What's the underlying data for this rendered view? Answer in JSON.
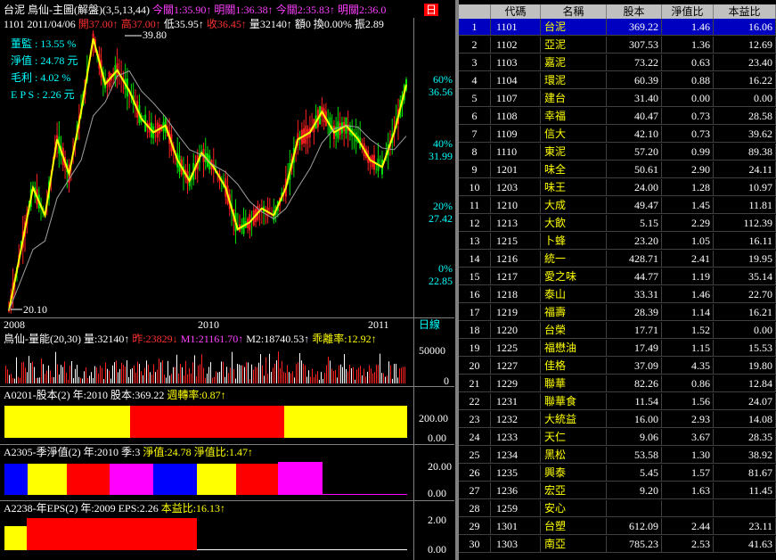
{
  "header": {
    "stock_name": "台泥",
    "title": "鳥仙-主圖(解盤)(3,5,13,44)",
    "today_close": "今關1:35.90↑",
    "tomorrow_close": "明關1:36.38↑",
    "today_close2": "今關2:35.83↑",
    "tomorrow_close2": "明關2:36.0",
    "flag": "日",
    "line2_code_date": "1101 2011/04/06",
    "open": "開37.00↑",
    "high": "高37.00↑",
    "low": "低35.95↑",
    "close": "收36.45↑",
    "volume": "量32140↑",
    "amount": "額0",
    "turnover": "換0.00%",
    "amplitude": "振2.89"
  },
  "overlay": {
    "supervisor": "董監 : 13.55 %",
    "net_value": "淨值 : 24.78 元",
    "gross_margin": "毛利 : 4.02 %",
    "eps": "E P S : 2.26 元"
  },
  "main_chart": {
    "price_high_label": "39.80",
    "price_low_label": "20.10",
    "right_axis": [
      {
        "pct": "60%",
        "price": "36.56"
      },
      {
        "pct": "40%",
        "price": "31.99"
      },
      {
        "pct": "20%",
        "price": "27.42"
      },
      {
        "pct": "0%",
        "price": "22.85"
      }
    ],
    "year_labels": [
      "2008",
      "2010",
      "2011"
    ],
    "period": "日線"
  },
  "chart_data": [
    {
      "type": "line",
      "title": "鳥仙-主圖(解盤)(3,5,13,44)",
      "series": [
        {
          "name": "price",
          "values": [
            20.1,
            24.5,
            29.0,
            27.0,
            32.5,
            30.0,
            34.5,
            39.8,
            36.5,
            37.5,
            36.0,
            34.0,
            33.0,
            33.5,
            31.0,
            29.5,
            31.5,
            30.5,
            29.0,
            26.0,
            26.5,
            27.5,
            27.0,
            29.0,
            32.5,
            33.0,
            34.5,
            33.0,
            33.5,
            32.5,
            31.0,
            30.5,
            33.0,
            36.45
          ]
        }
      ],
      "ylim": [
        20,
        40
      ]
    },
    {
      "type": "bar",
      "title": "鳥仙-量能(20,30)",
      "series": [
        {
          "name": "量",
          "values": [
            32140
          ]
        }
      ],
      "yticks": [
        0,
        50000
      ]
    },
    {
      "type": "bar",
      "title": "A0201-股本(2)",
      "values": [
        369.22
      ],
      "yticks": [
        "0.00",
        "200.00"
      ]
    },
    {
      "type": "bar",
      "title": "A2305-季淨值(2)",
      "values": [
        24.78
      ],
      "yticks": [
        "0.00",
        "20.00"
      ]
    },
    {
      "type": "bar",
      "title": "A2238-年EPS(2)",
      "values": [
        2.26
      ],
      "yticks": [
        "0.00",
        "2.00"
      ]
    }
  ],
  "volume_panel": {
    "title": "鳥仙-量能(20,30)",
    "vol": "量:32140↑",
    "vol2": "昨:23829↓",
    "m1": "M1:21161.70↑",
    "m2": "M2:18740.53↑",
    "ratio": "乖離率:12.92↑",
    "tick_high": "50000",
    "tick_low": "0"
  },
  "capital_panel": {
    "code": "A0201-股本(2)",
    "year_label": "年:2010",
    "value": "股本:369.22",
    "extra": "週轉率:0.87↑",
    "tick_high": "200.00",
    "tick_low": "0.00"
  },
  "netvalue_panel": {
    "code": "A2305-季淨值(2)",
    "year_label": "年:2010",
    "quarter": "季:3",
    "value": "淨值:24.78",
    "ratio": "淨值比:1.47↑",
    "tick_high": "20.00",
    "tick_low": "0.00"
  },
  "eps_panel": {
    "code": "A2238-年EPS(2)",
    "year_label": "年:2009",
    "value": "EPS:2.26",
    "ratio": "本益比:16.13↑",
    "tick_high": "2.00",
    "tick_low": "0.00"
  },
  "table": {
    "headers": [
      "",
      "代碼",
      "名稱",
      "股本",
      "淨值比",
      "本益比"
    ],
    "rows": [
      {
        "n": "1",
        "code": "1101",
        "name": "台泥",
        "cap": "369.22",
        "pb": "1.46",
        "pe": "16.06"
      },
      {
        "n": "2",
        "code": "1102",
        "name": "亞泥",
        "cap": "307.53",
        "pb": "1.36",
        "pe": "12.69"
      },
      {
        "n": "3",
        "code": "1103",
        "name": "嘉泥",
        "cap": "73.22",
        "pb": "0.63",
        "pe": "23.40"
      },
      {
        "n": "4",
        "code": "1104",
        "name": "環泥",
        "cap": "60.39",
        "pb": "0.88",
        "pe": "16.22"
      },
      {
        "n": "5",
        "code": "1107",
        "name": "建台",
        "cap": "31.40",
        "pb": "0.00",
        "pe": "0.00"
      },
      {
        "n": "6",
        "code": "1108",
        "name": "幸福",
        "cap": "40.47",
        "pb": "0.73",
        "pe": "28.58"
      },
      {
        "n": "7",
        "code": "1109",
        "name": "信大",
        "cap": "42.10",
        "pb": "0.73",
        "pe": "39.62"
      },
      {
        "n": "8",
        "code": "1110",
        "name": "東泥",
        "cap": "57.20",
        "pb": "0.99",
        "pe": "89.38"
      },
      {
        "n": "9",
        "code": "1201",
        "name": "味全",
        "cap": "50.61",
        "pb": "2.90",
        "pe": "24.11"
      },
      {
        "n": "10",
        "code": "1203",
        "name": "味王",
        "cap": "24.00",
        "pb": "1.28",
        "pe": "10.97"
      },
      {
        "n": "11",
        "code": "1210",
        "name": "大成",
        "cap": "49.47",
        "pb": "1.45",
        "pe": "11.81"
      },
      {
        "n": "12",
        "code": "1213",
        "name": "大飲",
        "cap": "5.15",
        "pb": "2.29",
        "pe": "112.39"
      },
      {
        "n": "13",
        "code": "1215",
        "name": "卜蜂",
        "cap": "23.20",
        "pb": "1.05",
        "pe": "16.11"
      },
      {
        "n": "14",
        "code": "1216",
        "name": "統一",
        "cap": "428.71",
        "pb": "2.41",
        "pe": "19.95"
      },
      {
        "n": "15",
        "code": "1217",
        "name": "愛之味",
        "cap": "44.77",
        "pb": "1.19",
        "pe": "35.14"
      },
      {
        "n": "16",
        "code": "1218",
        "name": "泰山",
        "cap": "33.31",
        "pb": "1.46",
        "pe": "22.70"
      },
      {
        "n": "17",
        "code": "1219",
        "name": "福壽",
        "cap": "28.39",
        "pb": "1.14",
        "pe": "16.21"
      },
      {
        "n": "18",
        "code": "1220",
        "name": "台榮",
        "cap": "17.71",
        "pb": "1.52",
        "pe": "0.00"
      },
      {
        "n": "19",
        "code": "1225",
        "name": "福懋油",
        "cap": "17.49",
        "pb": "1.15",
        "pe": "15.53"
      },
      {
        "n": "20",
        "code": "1227",
        "name": "佳格",
        "cap": "37.09",
        "pb": "4.35",
        "pe": "19.80"
      },
      {
        "n": "21",
        "code": "1229",
        "name": "聯華",
        "cap": "82.26",
        "pb": "0.86",
        "pe": "12.84"
      },
      {
        "n": "22",
        "code": "1231",
        "name": "聯華食",
        "cap": "11.54",
        "pb": "1.56",
        "pe": "24.07"
      },
      {
        "n": "23",
        "code": "1232",
        "name": "大統益",
        "cap": "16.00",
        "pb": "2.93",
        "pe": "14.08"
      },
      {
        "n": "24",
        "code": "1233",
        "name": "天仁",
        "cap": "9.06",
        "pb": "3.67",
        "pe": "28.35"
      },
      {
        "n": "25",
        "code": "1234",
        "name": "黑松",
        "cap": "53.58",
        "pb": "1.30",
        "pe": "38.92"
      },
      {
        "n": "26",
        "code": "1235",
        "name": "興泰",
        "cap": "5.45",
        "pb": "1.57",
        "pe": "81.67"
      },
      {
        "n": "27",
        "code": "1236",
        "name": "宏亞",
        "cap": "9.20",
        "pb": "1.63",
        "pe": "11.45"
      },
      {
        "n": "28",
        "code": "1259",
        "name": "安心",
        "cap": "",
        "pb": "",
        "pe": ""
      },
      {
        "n": "29",
        "code": "1301",
        "name": "台塑",
        "cap": "612.09",
        "pb": "2.44",
        "pe": "23.11"
      },
      {
        "n": "30",
        "code": "1303",
        "name": "南亞",
        "cap": "785.23",
        "pb": "2.53",
        "pe": "41.63"
      }
    ]
  },
  "colors": {
    "yellow": "#ffff00",
    "red": "#ff0000",
    "magenta": "#ff00ff",
    "blue": "#0000ff",
    "cyan": "#00ffff"
  }
}
